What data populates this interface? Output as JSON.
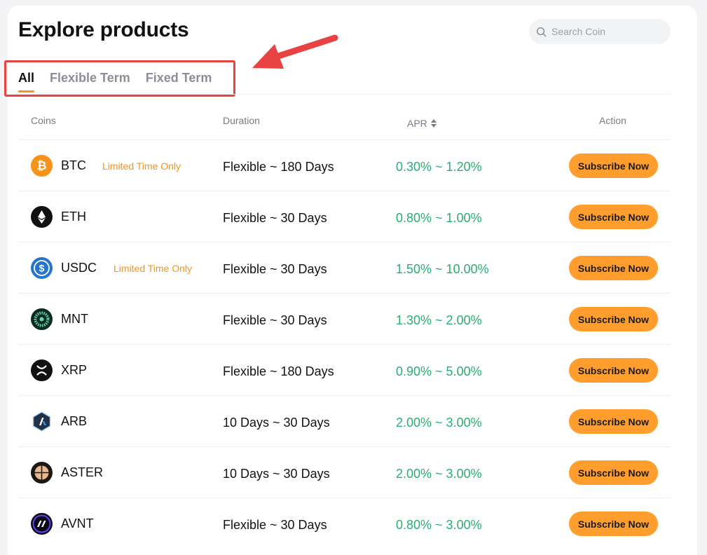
{
  "page": {
    "title": "Explore products",
    "search_placeholder": "Search Coin"
  },
  "tabs": [
    {
      "label": "All",
      "active": true
    },
    {
      "label": "Flexible Term",
      "active": false
    },
    {
      "label": "Fixed Term",
      "active": false
    }
  ],
  "table": {
    "headers": {
      "coins": "Coins",
      "duration": "Duration",
      "apr": "APR",
      "action": "Action"
    },
    "rows": [
      {
        "coin": "BTC",
        "tag": "Limited Time Only",
        "duration": "Flexible ~ 180 Days",
        "apr": "0.30% ~ 1.20%",
        "action": "Subscribe Now",
        "icon": "btc-icon"
      },
      {
        "coin": "ETH",
        "tag": "",
        "duration": "Flexible ~ 30 Days",
        "apr": "0.80% ~ 1.00%",
        "action": "Subscribe Now",
        "icon": "eth-icon"
      },
      {
        "coin": "USDC",
        "tag": "Limited Time Only",
        "duration": "Flexible ~ 30 Days",
        "apr": "1.50% ~ 10.00%",
        "action": "Subscribe Now",
        "icon": "usdc-icon"
      },
      {
        "coin": "MNT",
        "tag": "",
        "duration": "Flexible ~ 30 Days",
        "apr": "1.30% ~ 2.00%",
        "action": "Subscribe Now",
        "icon": "mnt-icon"
      },
      {
        "coin": "XRP",
        "tag": "",
        "duration": "Flexible ~ 180 Days",
        "apr": "0.90% ~ 5.00%",
        "action": "Subscribe Now",
        "icon": "xrp-icon"
      },
      {
        "coin": "ARB",
        "tag": "",
        "duration": "10 Days ~ 30 Days",
        "apr": "2.00% ~ 3.00%",
        "action": "Subscribe Now",
        "icon": "arb-icon"
      },
      {
        "coin": "ASTER",
        "tag": "",
        "duration": "10 Days ~ 30 Days",
        "apr": "2.00% ~ 3.00%",
        "action": "Subscribe Now",
        "icon": "aster-icon"
      },
      {
        "coin": "AVNT",
        "tag": "",
        "duration": "Flexible ~ 30 Days",
        "apr": "0.80% ~ 3.00%",
        "action": "Subscribe Now",
        "icon": "avnt-icon"
      }
    ]
  },
  "colors": {
    "accent": "#ff9e2c",
    "tag": "#f7931a",
    "apr_green": "#27ae73",
    "annotation_red": "#e84242"
  }
}
